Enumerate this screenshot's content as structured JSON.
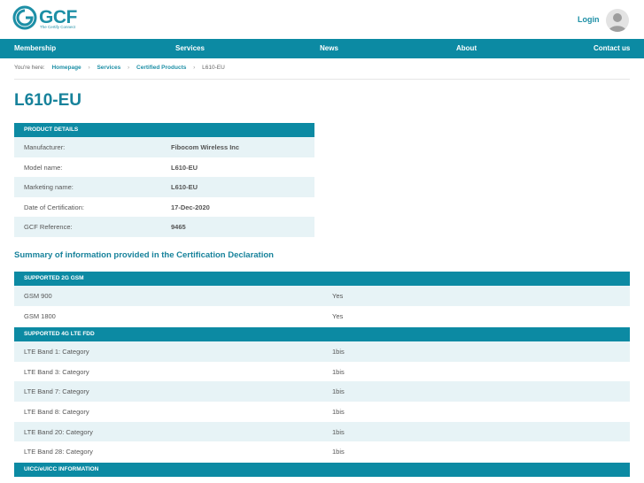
{
  "header": {
    "logo_text": "GCF",
    "logo_tagline": "The Certify Connect",
    "login_label": "Login"
  },
  "nav": {
    "items": [
      "Membership",
      "Services",
      "News",
      "About",
      "Contact us"
    ]
  },
  "breadcrumb": {
    "prefix": "You're here:",
    "items": [
      "Homepage",
      "Services",
      "Certified Products",
      "L610-EU"
    ]
  },
  "page_title": "L610-EU",
  "product_details": {
    "header": "PRODUCT DETAILS",
    "rows": [
      {
        "label": "Manufacturer:",
        "value": "Fibocom Wireless Inc"
      },
      {
        "label": "Model name:",
        "value": "L610-EU"
      },
      {
        "label": "Marketing name:",
        "value": "L610-EU"
      },
      {
        "label": "Date of Certification:",
        "value": "17-Dec-2020"
      },
      {
        "label": "GCF Reference:",
        "value": "9465"
      }
    ]
  },
  "summary_heading": "Summary of information provided in the Certification Declaration",
  "sections": {
    "gsm": {
      "header": "SUPPORTED 2G GSM",
      "rows": [
        {
          "label": "GSM 900",
          "value": "Yes"
        },
        {
          "label": "GSM 1800",
          "value": "Yes"
        }
      ]
    },
    "lte": {
      "header": "SUPPORTED 4G LTE FDD",
      "rows": [
        {
          "label": "LTE Band 1: Category",
          "value": "1bis"
        },
        {
          "label": "LTE Band 3: Category",
          "value": "1bis"
        },
        {
          "label": "LTE Band 7: Category",
          "value": "1bis"
        },
        {
          "label": "LTE Band 8: Category",
          "value": "1bis"
        },
        {
          "label": "LTE Band 20: Category",
          "value": "1bis"
        },
        {
          "label": "LTE Band 28: Category",
          "value": "1bis"
        }
      ]
    },
    "uicc": {
      "header": "UICC/eUICC INFORMATION"
    }
  },
  "colors": {
    "brand_teal": "#0c8aa3",
    "title_teal": "#17829b",
    "row_alt": "#e7f3f6"
  }
}
